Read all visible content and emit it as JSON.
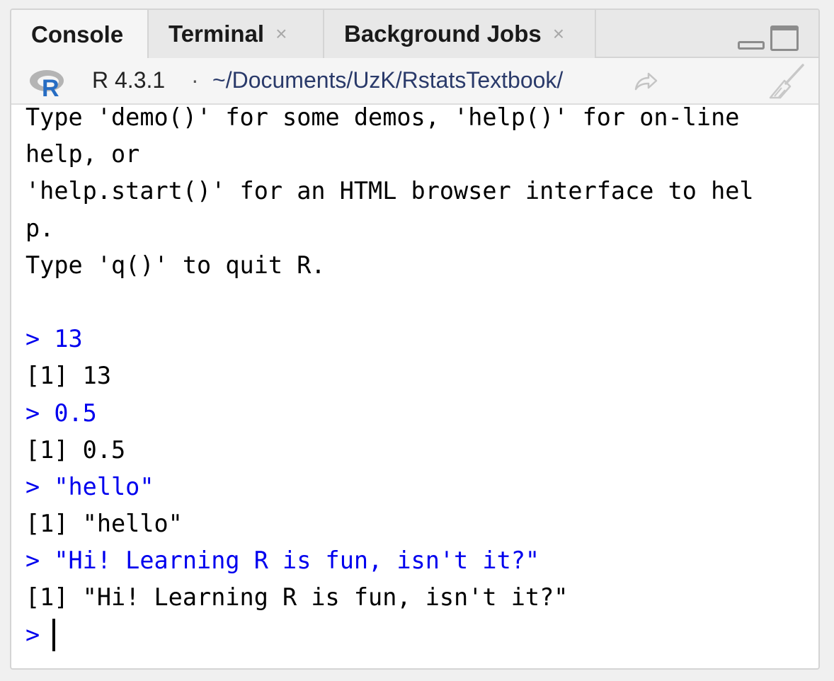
{
  "tabs": [
    {
      "label": "Console",
      "active": true,
      "closable": false
    },
    {
      "label": "Terminal",
      "active": false,
      "closable": true
    },
    {
      "label": "Background Jobs",
      "active": false,
      "closable": true
    }
  ],
  "close_glyph": "×",
  "pathbar": {
    "r_version": "R 4.3.1",
    "separator": "·",
    "working_dir": "~/Documents/UzK/RstatsTextbook/"
  },
  "colors": {
    "command": "#0000ee",
    "output": "#000000",
    "r_logo_blue": "#276dc3",
    "r_logo_gray": "#a8a8a8"
  },
  "console": {
    "lines": [
      {
        "text": "Type 'demo()' for some demos, 'help()' for on-line",
        "type": "output"
      },
      {
        "text": "help, or",
        "type": "output"
      },
      {
        "text": "'help.start()' for an HTML browser interface to hel",
        "type": "output"
      },
      {
        "text": "p.",
        "type": "output"
      },
      {
        "text": "Type 'q()' to quit R.",
        "type": "output"
      },
      {
        "text": "",
        "type": "output"
      },
      {
        "text": "> 13",
        "type": "command"
      },
      {
        "text": "[1] 13",
        "type": "output"
      },
      {
        "text": "> 0.5",
        "type": "command"
      },
      {
        "text": "[1] 0.5",
        "type": "output"
      },
      {
        "text": "> \"hello\"",
        "type": "command"
      },
      {
        "text": "[1] \"hello\"",
        "type": "output"
      },
      {
        "text": "> \"Hi! Learning R is fun, isn't it?\"",
        "type": "command"
      },
      {
        "text": "[1] \"Hi! Learning R is fun, isn't it?\"",
        "type": "output"
      }
    ],
    "prompt": ">"
  },
  "icons": {
    "r_logo": "r-logo-icon",
    "goto_dir": "goto-directory-icon",
    "clear": "broom-icon",
    "minimize": "minimize-icon",
    "maximize": "maximize-icon"
  }
}
